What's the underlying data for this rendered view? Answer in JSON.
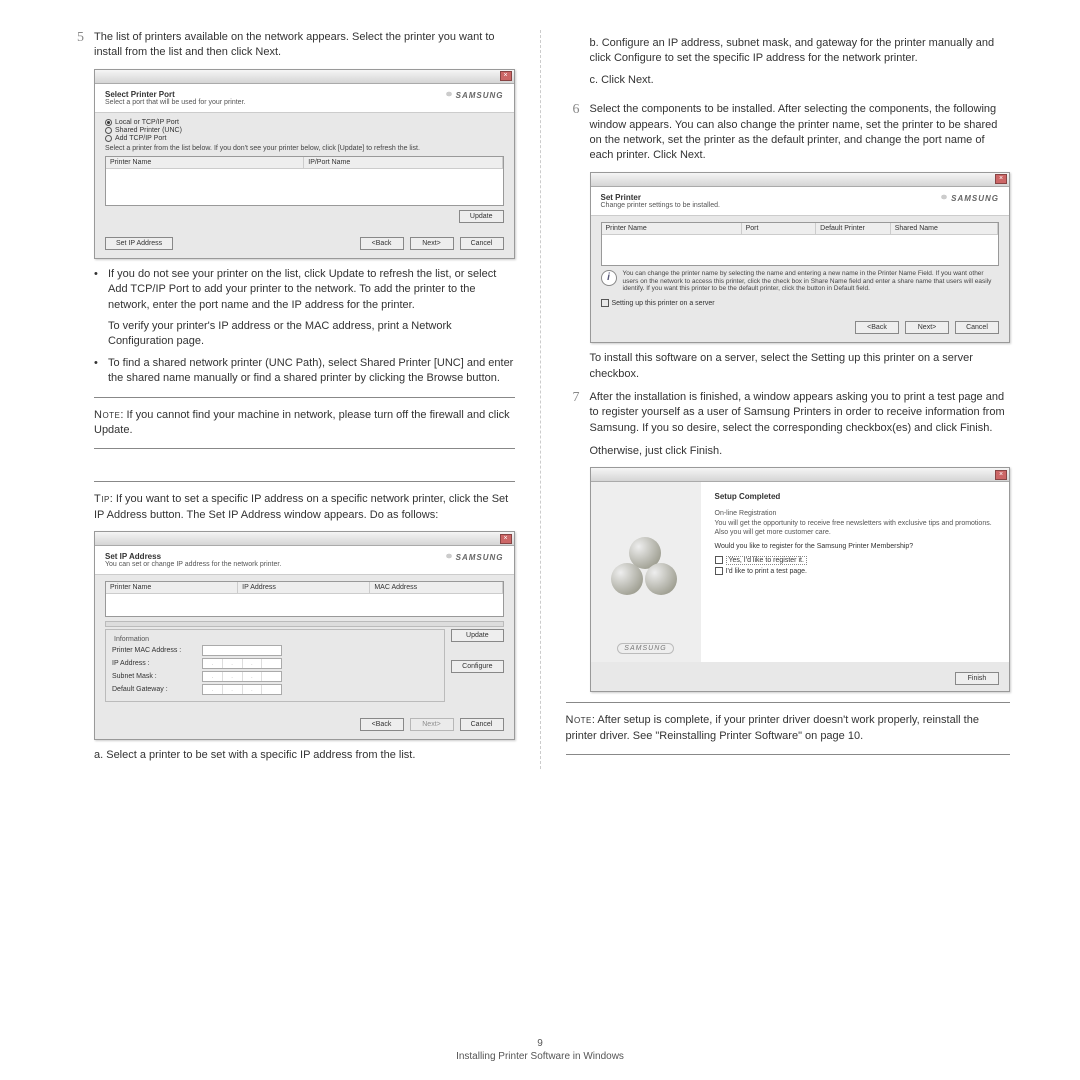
{
  "footer": {
    "page_num": "9",
    "section": "Installing Printer Software in Windows"
  },
  "left": {
    "step5": {
      "num": "5",
      "text": "The list of printers available on the network appears. Select the printer you want to install from the list and then click Next."
    },
    "dlg1": {
      "title": "Select Printer Port",
      "sub": "Select a port that will be used for your printer.",
      "brand": "SAMSUNG",
      "r1": "Local or TCP/IP Port",
      "r2": "Shared Printer (UNC)",
      "r3": "Add TCP/IP Port",
      "instr": "Select a printer from the list below. If you don't see your printer below, click [Update] to refresh the list.",
      "col1": "Printer Name",
      "col2": "IP/Port Name",
      "update": "Update",
      "setip": "Set IP Address",
      "back": "<Back",
      "next": "Next>",
      "cancel": "Cancel"
    },
    "b1": "If you do not see your printer on the list, click Update to refresh the list, or select Add TCP/IP Port to add your printer to the network. To add the printer to the network, enter the port name and the IP address for the printer.",
    "b1b": "To verify your printer's IP address or the MAC address, print a Network Configuration page.",
    "b2": "To find a shared network printer (UNC Path), select Shared Printer [UNC] and enter the shared name manually or find a shared printer by clicking the Browse button.",
    "note_label": "Note",
    "note": ": If you cannot find your machine in network, please turn off the firewall and click Update.",
    "tip_label": "Tip",
    "tip": ": If you want to set a specific IP address on a specific network printer, click the Set IP Address button. The Set IP Address window appears. Do as follows:",
    "dlg2": {
      "title": "Set IP Address",
      "sub": "You can set or change IP address for the network printer.",
      "brand": "SAMSUNG",
      "col1": "Printer Name",
      "col2": "IP Address",
      "col3": "MAC Address",
      "info_legend": "Information",
      "mac": "Printer MAC Address :",
      "ip": "IP Address :",
      "mask": "Subnet Mask :",
      "gw": "Default Gateway :",
      "update": "Update",
      "configure": "Configure",
      "back": "<Back",
      "next": "Next>",
      "cancel": "Cancel"
    },
    "sa": "a. Select a printer to be set with a specific IP address from the list."
  },
  "right": {
    "sb": "b. Configure an IP address, subnet mask, and gateway for the printer manually and click Configure to set the specific IP address for the network printer.",
    "sc": "c. Click Next.",
    "step6": {
      "num": "6",
      "text": "Select the components to be installed. After selecting the components, the following window appears. You can also change the printer name, set the printer to be shared on the network, set the printer as the default printer, and change the port name of each printer. Click Next."
    },
    "dlg3": {
      "title": "Set Printer",
      "sub": "Change printer settings to be installed.",
      "brand": "SAMSUNG",
      "c1": "Printer Name",
      "c2": "Port",
      "c3": "Default Printer",
      "c4": "Shared Name",
      "info": "You can change the printer name by selecting the name and entering a new name in the Printer Name Field. If you want other users on the network to access this printer, click the check box in Share Name field and enter a share name that users will easily identify. If you want this printer to be the default printer, click the button in Default field.",
      "chk": "Setting up this printer on a server",
      "back": "<Back",
      "next": "Next>",
      "cancel": "Cancel"
    },
    "p_install": "To install this software on a server, select the Setting up this printer on a server checkbox.",
    "step7": {
      "num": "7",
      "text": "After the installation is finished, a window appears asking you to print a test page and to register yourself as a user of Samsung Printers in order to receive information from Samsung. If you so desire, select the corresponding checkbox(es) and click Finish."
    },
    "p_otherwise": "Otherwise, just click Finish.",
    "dlg4": {
      "h": "Setup Completed",
      "sub_h": "On-line Registration",
      "sub": "You will get the opportunity to receive free newsletters with exclusive tips and promotions. Also you will get more customer care.",
      "q": "Would you like to register for the Samsung Printer Membership?",
      "c1": "Yes, I'd like to register it.",
      "c2": "I'd like to print a test page.",
      "brand": "SAMSUNG",
      "finish": "Finish"
    },
    "note_label": "Note",
    "note": ": After setup is complete, if your printer driver doesn't work properly, reinstall the printer driver. See \"Reinstalling Printer Software\" on page 10."
  }
}
